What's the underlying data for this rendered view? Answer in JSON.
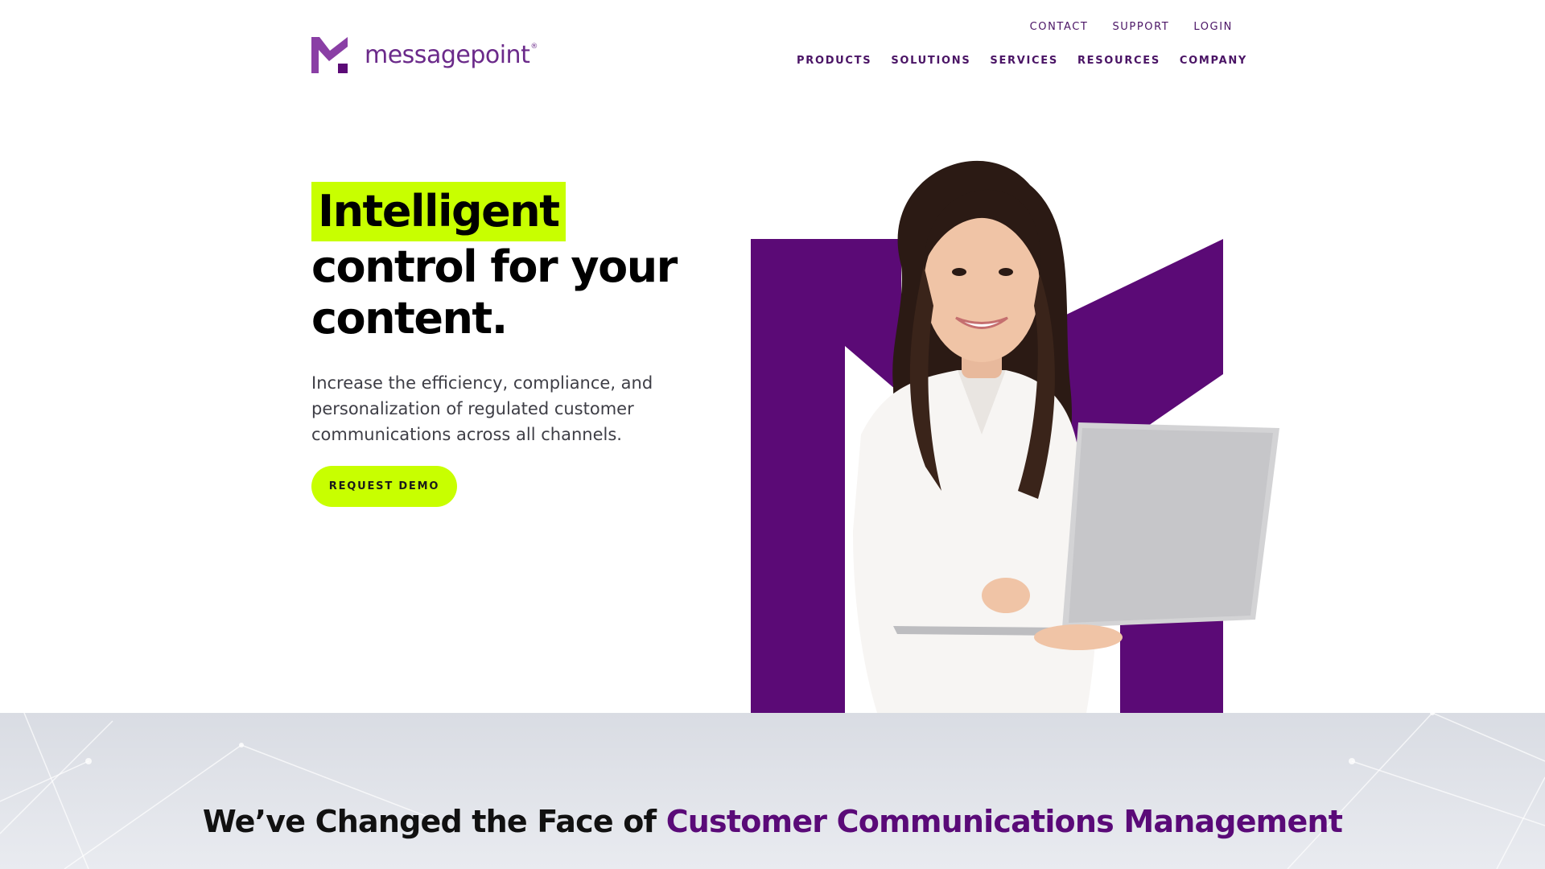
{
  "brand": {
    "name": "messagepoint",
    "registered_mark": "®",
    "colors": {
      "purple": "#5b0a76",
      "lime": "#c8ff00",
      "text_dark": "#000000"
    }
  },
  "utility_nav": {
    "contact": "CONTACT",
    "support": "SUPPORT",
    "login": "LOGIN"
  },
  "main_nav": {
    "products": "PRODUCTS",
    "solutions": "SOLUTIONS",
    "services": "SERVICES",
    "resources": "RESOURCES",
    "company": "COMPANY"
  },
  "hero": {
    "title_highlight": "Intelligent",
    "title_line2": "control for your",
    "title_line3": "content.",
    "subtitle": "Increase the efficiency, compliance, and personalization of regulated customer communications across all channels.",
    "cta_label": "REQUEST DEMO"
  },
  "section": {
    "heading_plain": "We’ve Changed the Face of ",
    "heading_accent": "Customer Communications Management"
  }
}
